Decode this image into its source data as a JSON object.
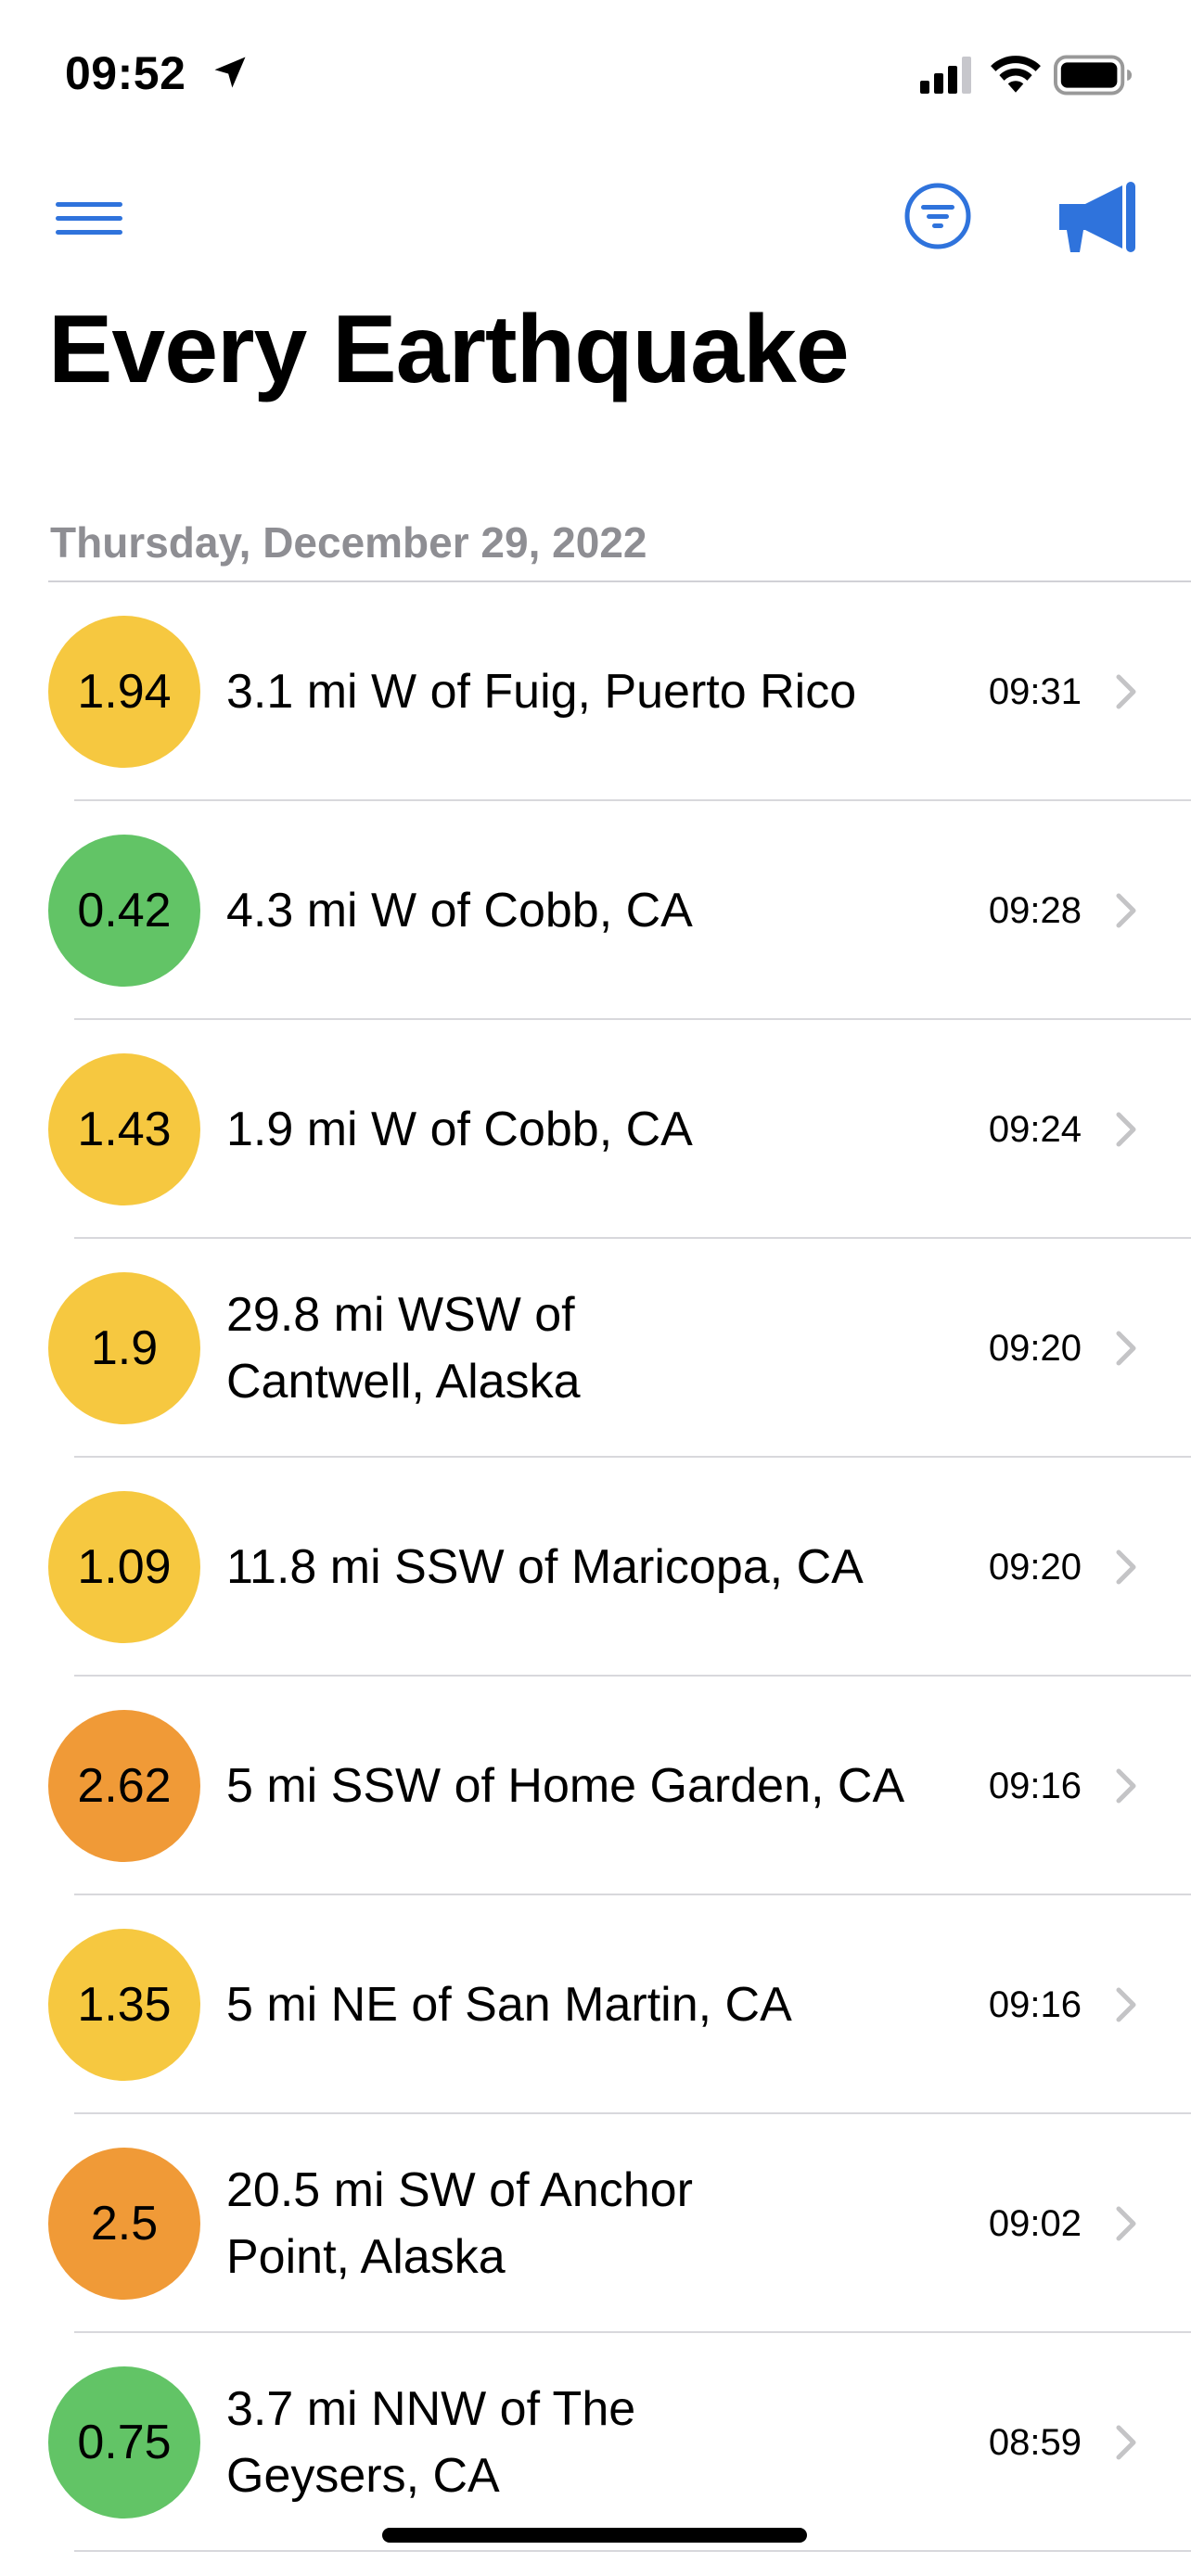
{
  "status_bar": {
    "time": "09:52",
    "icons": [
      "location-arrow-icon",
      "cellular-signal-icon",
      "wifi-icon",
      "battery-icon"
    ]
  },
  "nav": {
    "icons": [
      "hamburger-menu-icon",
      "filter-icon",
      "megaphone-icon"
    ]
  },
  "page_title": "Every Earthquake",
  "section": {
    "date": "Thursday, December 29, 2022"
  },
  "colors": {
    "accent": "#2f73dc",
    "yellow": "#f6c840",
    "green": "#62c466",
    "orange": "#f09a37",
    "secondary_text": "#8e8e93",
    "chevron": "#c4c4c6"
  },
  "earthquakes": [
    {
      "magnitude": "1.94",
      "place": "3.1 mi W of Fuig, Puerto Rico",
      "time": "09:31",
      "color": "#f6c840"
    },
    {
      "magnitude": "0.42",
      "place": "4.3 mi W of Cobb, CA",
      "time": "09:28",
      "color": "#62c466"
    },
    {
      "magnitude": "1.43",
      "place": "1.9 mi W of Cobb, CA",
      "time": "09:24",
      "color": "#f6c840"
    },
    {
      "magnitude": "1.9",
      "place": "29.8 mi WSW of Cantwell, Alaska",
      "time": "09:20",
      "color": "#f6c840"
    },
    {
      "magnitude": "1.09",
      "place": "11.8 mi SSW of Maricopa, CA",
      "time": "09:20",
      "color": "#f6c840"
    },
    {
      "magnitude": "2.62",
      "place": "5 mi SSW of Home Garden, CA",
      "time": "09:16",
      "color": "#f09a37"
    },
    {
      "magnitude": "1.35",
      "place": "5 mi NE of San Martin, CA",
      "time": "09:16",
      "color": "#f6c840"
    },
    {
      "magnitude": "2.5",
      "place": "20.5 mi SW of Anchor Point, Alaska",
      "time": "09:02",
      "color": "#f09a37"
    },
    {
      "magnitude": "0.75",
      "place": "3.7 mi NNW of The Geysers, CA",
      "time": "08:59",
      "color": "#62c466"
    }
  ]
}
